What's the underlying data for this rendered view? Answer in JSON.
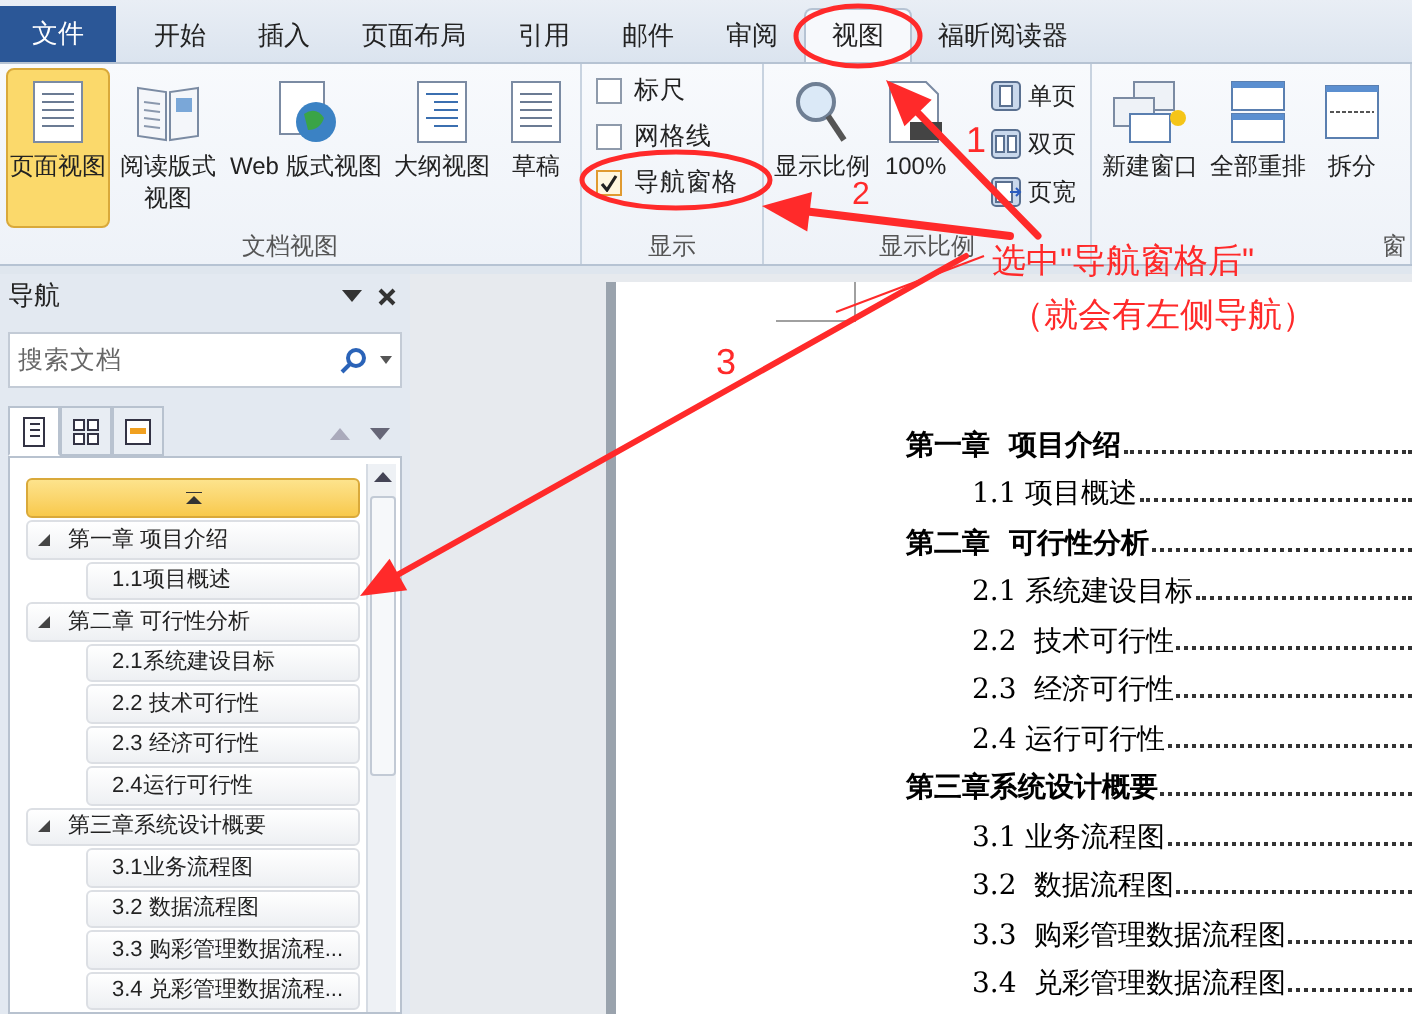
{
  "tabs": [
    {
      "label": "文件",
      "kind": "file",
      "selected": false
    },
    {
      "label": "开始",
      "kind": "tab",
      "selected": false
    },
    {
      "label": "插入",
      "kind": "tab",
      "selected": false
    },
    {
      "label": "页面布局",
      "kind": "tab",
      "selected": false
    },
    {
      "label": "引用",
      "kind": "tab",
      "selected": false
    },
    {
      "label": "邮件",
      "kind": "tab",
      "selected": false
    },
    {
      "label": "审阅",
      "kind": "tab",
      "selected": false
    },
    {
      "label": "视图",
      "kind": "tab",
      "selected": true
    },
    {
      "label": "福昕阅读器",
      "kind": "tab",
      "selected": false
    }
  ],
  "ribbon": {
    "groups": [
      {
        "label": "文档视图",
        "items": [
          {
            "label": "页面视图",
            "kind": "page",
            "selected": true
          },
          {
            "label": "阅读版式视图",
            "kind": "reading",
            "selected": false
          },
          {
            "label": "Web 版式视图",
            "kind": "web",
            "selected": false
          },
          {
            "label": "大纲视图",
            "kind": "outline",
            "selected": false
          },
          {
            "label": "草稿",
            "kind": "draft",
            "selected": false
          }
        ]
      },
      {
        "label": "显示",
        "checkboxes": [
          {
            "label": "标尺",
            "checked": false
          },
          {
            "label": "网格线",
            "checked": false
          },
          {
            "label": "导航窗格",
            "checked": true
          }
        ]
      },
      {
        "label": "显示比例",
        "items": [
          {
            "label": "显示比例",
            "kind": "zoom"
          },
          {
            "label": "100%",
            "kind": "hundred"
          }
        ],
        "small_items": [
          {
            "label": "单页",
            "kind": "one"
          },
          {
            "label": "双页",
            "kind": "two"
          },
          {
            "label": "页宽",
            "kind": "width"
          }
        ]
      },
      {
        "label": "窗",
        "items": [
          {
            "label": "新建窗口",
            "kind": "newwin"
          },
          {
            "label": "全部重排",
            "kind": "arrange"
          },
          {
            "label": "拆分",
            "kind": "split"
          }
        ]
      }
    ]
  },
  "navigation": {
    "title": "导航",
    "search": {
      "placeholder": "搜索文档"
    },
    "view_tabs": [
      {
        "kind": "headings",
        "selected": true
      },
      {
        "kind": "pages",
        "selected": false
      },
      {
        "kind": "results",
        "selected": false
      }
    ],
    "tree": [
      {
        "label": "第一章 项目介绍",
        "expanded": true,
        "children": [
          {
            "label": "1.1项目概述"
          }
        ]
      },
      {
        "label": "第二章 可行性分析",
        "expanded": true,
        "children": [
          {
            "label": "2.1系统建设目标"
          },
          {
            "label": "2.2 技术可行性"
          },
          {
            "label": "2.3 经济可行性"
          },
          {
            "label": "2.4运行可行性"
          }
        ]
      },
      {
        "label": "第三章系统设计概要",
        "expanded": true,
        "children": [
          {
            "label": "3.1业务流程图"
          },
          {
            "label": "3.2 数据流程图"
          },
          {
            "label": "3.3 购彩管理数据流程..."
          },
          {
            "label": "3.4 兑彩管理数据流程..."
          }
        ]
      }
    ]
  },
  "document": {
    "toc": [
      {
        "label": "第一章  项目介绍",
        "children": [
          {
            "label": "1.1 项目概述"
          }
        ]
      },
      {
        "label": "第二章  可行性分析",
        "children": [
          {
            "label": "2.1 系统建设目标"
          },
          {
            "label": "2.2  技术可行性"
          },
          {
            "label": "2.3  经济可行性"
          },
          {
            "label": "2.4 运行可行性"
          }
        ]
      },
      {
        "label": "第三章系统设计概要",
        "children": [
          {
            "label": "3.1 业务流程图"
          },
          {
            "label": "3.2  数据流程图"
          },
          {
            "label": "3.3  购彩管理数据流程图"
          },
          {
            "label": "3.4  兑彩管理数据流程图"
          }
        ]
      }
    ]
  },
  "annotations": {
    "numbers": [
      "1",
      "2",
      "3"
    ],
    "note": [
      "选中\"导航窗格后\"",
      "（就会有左侧导航）"
    ]
  }
}
